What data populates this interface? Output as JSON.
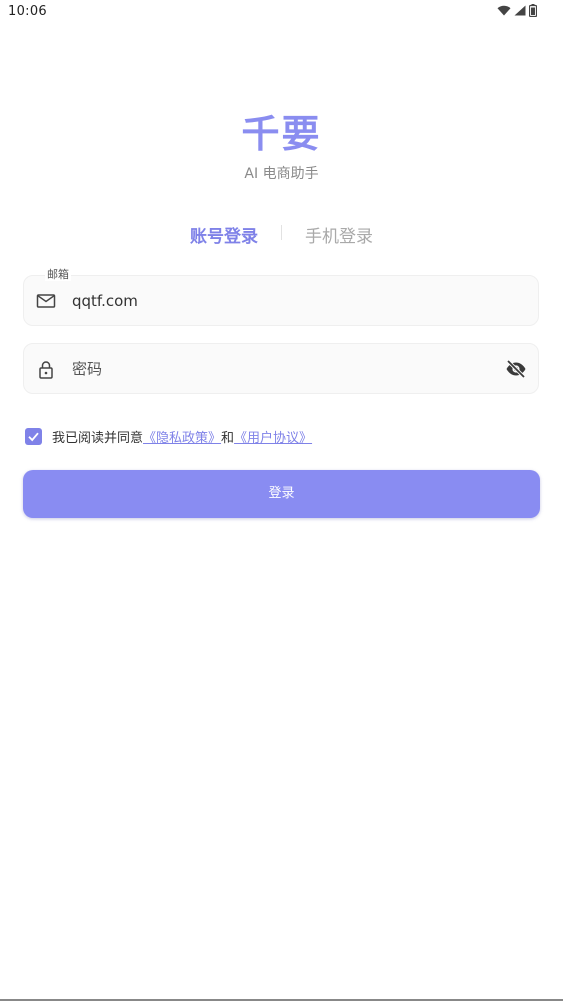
{
  "status_bar": {
    "time": "10:06",
    "icons": [
      "wifi-icon",
      "signal-icon",
      "battery-icon"
    ]
  },
  "app": {
    "title": "千要",
    "subtitle": "AI 电商助手"
  },
  "tabs": [
    {
      "label": "账号登录",
      "active": true
    },
    {
      "label": "手机登录",
      "active": false
    }
  ],
  "email_field": {
    "label": "邮箱",
    "value": "qqtf.com",
    "icon": "mail-icon"
  },
  "password_field": {
    "placeholder": "密码",
    "icon": "lock-icon",
    "toggle_icon": "eye-off-icon"
  },
  "agreement": {
    "checked": true,
    "prefix": "我已阅读并同意",
    "privacy_link": "《隐私政策》",
    "conjunction": "和",
    "user_link": "《用户协议》"
  },
  "login_button": {
    "label": "登录"
  },
  "colors": {
    "accent": "#7f82e8",
    "button": "#898cf2",
    "title": "#8a8df0"
  }
}
